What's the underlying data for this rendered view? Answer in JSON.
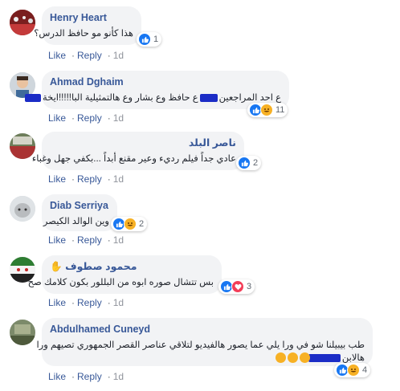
{
  "action_labels": {
    "like": "Like",
    "reply": "Reply",
    "separator": "·"
  },
  "comments": [
    {
      "author": "Henry Heart",
      "text": "هذا كأنو مو حافظ الدرس؟",
      "reaction_count": "1",
      "time": "1d"
    },
    {
      "author": "Ahmad Dghaim",
      "text_part1": "ع احد المراجعين",
      "text_part2": "ع حافظ وع بشار وع هالتمثيلية البا!!!!!ايخة",
      "reaction_count": "11",
      "time": "1d"
    },
    {
      "author": "ناصر البلد",
      "text": "عادي جداً فيلم رديء وعير مقنع أبداً ...بكفي جهل وغباء",
      "reaction_count": "2",
      "time": "1d"
    },
    {
      "author": "Diab Serriya",
      "text": "وين الوالد الكيصر",
      "reaction_count": "2",
      "time": "1d"
    },
    {
      "author": "محمود صطوف",
      "text": "بس تتشال صوره ابوه من البللور بكون كلامك صح",
      "reaction_count": "3",
      "time": "1d"
    },
    {
      "author": "Abdulhamed Cuneyd",
      "text_line1": "طب بيبيلنا شو في ورا يلي عما يصور هالفيديو لتلاقي عناصر القصر الجمهوري تصيهم ورا",
      "text_line2": "هالابن",
      "reaction_count": "4",
      "time": "1d"
    }
  ],
  "colors": {
    "link": "#385898",
    "bubble": "#f2f3f5",
    "like": "#1877f2",
    "haha": "#f7b125",
    "love": "#f33e58",
    "redaction": "#1b2cc6"
  }
}
